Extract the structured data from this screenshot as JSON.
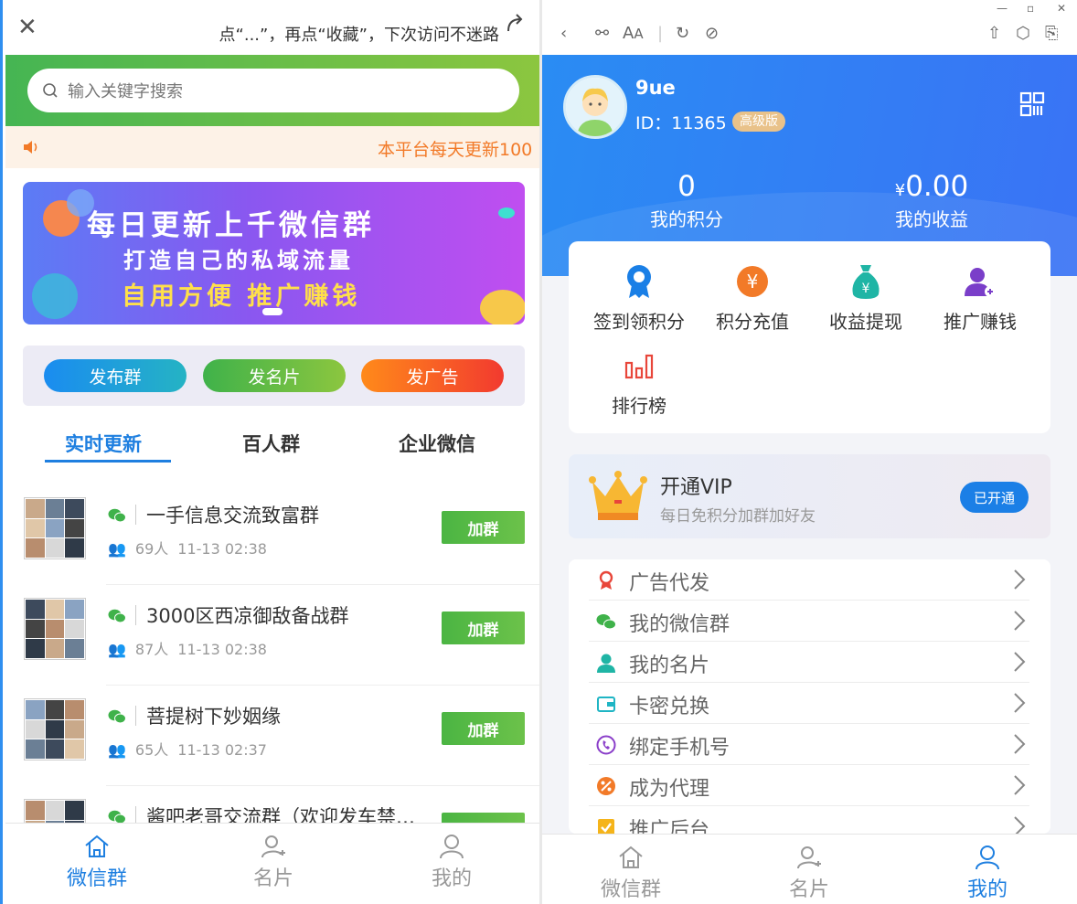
{
  "left": {
    "header": {
      "tip": "点“...”，再点“收藏”，下次访问不迷路"
    },
    "search": {
      "placeholder": "输入关键字搜索"
    },
    "notice": {
      "text": "本平台每天更新100"
    },
    "banner": {
      "line1": "每日更新上千微信群",
      "line2": "打造自己的私域流量",
      "line3": "自用方便 推广赚钱"
    },
    "actions": [
      {
        "label": "发布群",
        "color_from": "#1a8cf0",
        "color_to": "#25b3c4"
      },
      {
        "label": "发名片",
        "color_from": "#3fb24a",
        "color_to": "#8cc63f"
      },
      {
        "label": "发广告",
        "color_from": "#ff8a1a",
        "color_to": "#f23a2f"
      }
    ],
    "tabs": [
      "实时更新",
      "百人群",
      "企业微信"
    ],
    "groups": [
      {
        "name": "一手信息交流致富群",
        "members": "69人",
        "time": "11-13 02:38",
        "join": "加群"
      },
      {
        "name": "3000区西凉御敌备战群",
        "members": "87人",
        "time": "11-13 02:38",
        "join": "加群"
      },
      {
        "name": "菩提树下妙姻缘",
        "members": "65人",
        "time": "11-13 02:37",
        "join": "加群"
      },
      {
        "name": "酱吧老哥交流群（欢迎发车禁…",
        "members": "",
        "time": "",
        "join": ""
      }
    ],
    "nav": [
      {
        "label": "微信群",
        "icon": "home-icon",
        "active": true
      },
      {
        "label": "名片",
        "icon": "user-add-icon",
        "active": false
      },
      {
        "label": "我的",
        "icon": "user-icon",
        "active": false
      }
    ]
  },
  "right": {
    "profile": {
      "name": "9ue",
      "id_label": "ID：",
      "id": "11365",
      "badge": "高级版"
    },
    "stats": [
      {
        "value": "0",
        "prefix": "",
        "label": "我的积分"
      },
      {
        "value": "0.00",
        "prefix": "¥",
        "label": "我的收益"
      }
    ],
    "features": [
      {
        "label": "签到领积分",
        "icon": "badge-icon",
        "color": "#1a7fe6"
      },
      {
        "label": "积分充值",
        "icon": "yen-coin-icon",
        "color": "#f27a28"
      },
      {
        "label": "收益提现",
        "icon": "money-bag-icon",
        "color": "#1fb5a5"
      },
      {
        "label": "推广赚钱",
        "icon": "user-plus-icon",
        "color": "#7a3ec9"
      },
      {
        "label": "排行榜",
        "icon": "bar-chart-icon",
        "color": "#e8463a"
      }
    ],
    "vip": {
      "title": "开通VIP",
      "subtitle": "每日免积分加群加好友",
      "button": "已开通"
    },
    "menu": [
      {
        "label": "广告代发",
        "icon": "ribbon-icon",
        "color": "#e8463a"
      },
      {
        "label": "我的微信群",
        "icon": "wechat-icon",
        "color": "#3fb24a"
      },
      {
        "label": "我的名片",
        "icon": "person-icon",
        "color": "#1fb5a5"
      },
      {
        "label": "卡密兑换",
        "icon": "wallet-icon",
        "color": "#1fb5c4"
      },
      {
        "label": "绑定手机号",
        "icon": "phone-icon",
        "color": "#8a3ec9"
      },
      {
        "label": "成为代理",
        "icon": "percent-icon",
        "color": "#f27a28"
      },
      {
        "label": "推广后台",
        "icon": "checkbox-icon",
        "color": "#f5b41a"
      }
    ],
    "nav": [
      {
        "label": "微信群",
        "icon": "home-icon",
        "active": false
      },
      {
        "label": "名片",
        "icon": "user-add-icon",
        "active": false
      },
      {
        "label": "我的",
        "icon": "user-icon",
        "active": true
      }
    ]
  }
}
